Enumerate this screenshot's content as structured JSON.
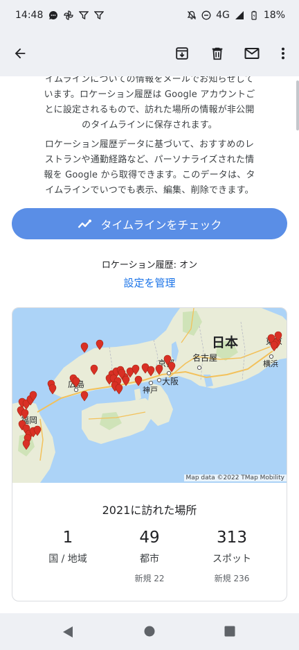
{
  "status_bar": {
    "time": "14:48",
    "network": "4G",
    "battery": "18%",
    "icons": [
      "message-icon",
      "pinwheel-icon",
      "funnel-icon",
      "funnel-icon",
      "notifications-off-icon",
      "do-not-disturb-icon",
      "signal-icon",
      "battery-icon"
    ]
  },
  "app_bar": {
    "icons": [
      "back-arrow-icon",
      "archive-icon",
      "delete-icon",
      "mail-icon",
      "more-vert-icon"
    ]
  },
  "body": {
    "paragraph1": [
      "イムラインについての情報をメールでお知らせして",
      "います。ロケーション履歴は Google アカウントご",
      "とに設定されるもので、訪れた場所の情報が非公開",
      "のタイムラインに保存されます。"
    ],
    "paragraph2": [
      "ロケーション履歴データに基づいて、おすすめのレ",
      "ストランや通勤経路など、パーソナライズされた情",
      "報を Google から取得できます。このデータは、タ",
      "イムラインでいつでも表示、編集、削除できます。"
    ],
    "timeline_button": "タイムラインをチェック",
    "location_history_status": "ロケーション履歴: オン",
    "manage_settings_link": "設定を管理"
  },
  "map_card": {
    "map_labels": {
      "country": "日本",
      "tokyo": "東京",
      "yokohama": "横浜",
      "nagoya": "名古屋",
      "kyoto": "京都",
      "osaka": "大阪",
      "kobe": "神戸",
      "hiroshima": "広島",
      "fukuoka": "福岡"
    },
    "attribution": "Map data ©2022 TMap Mobility",
    "title": "2021に訪れた場所",
    "stats": [
      {
        "value": "1",
        "label": "国 / 地域",
        "sub": ""
      },
      {
        "value": "49",
        "label": "都市",
        "sub": "新規 22"
      },
      {
        "value": "313",
        "label": "スポット",
        "sub": "新規 236"
      }
    ]
  },
  "colors": {
    "bar_background": "#eef0f4",
    "button_blue": "#5a8ee6",
    "link_blue": "#1a73e8",
    "sea": "#acd3f7",
    "land": "#e9ecd8",
    "pin_red": "#d93025"
  }
}
